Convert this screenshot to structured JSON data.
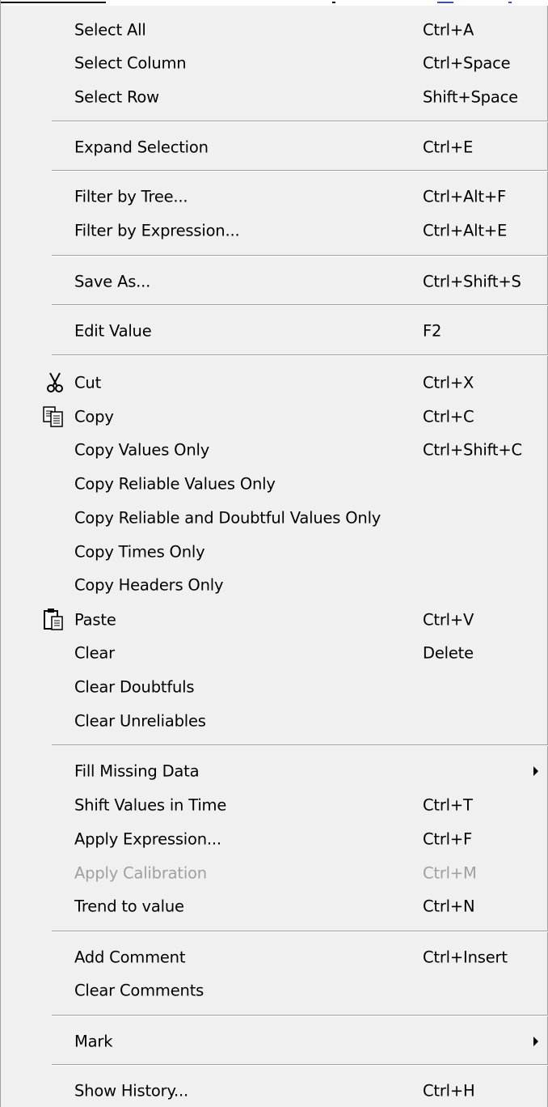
{
  "menu": {
    "items": [
      {
        "label": "Select All",
        "shortcut": "Ctrl+A"
      },
      {
        "label": "Select Column",
        "shortcut": "Ctrl+Space"
      },
      {
        "label": "Select Row",
        "shortcut": "Shift+Space"
      },
      {
        "label": "Expand Selection",
        "shortcut": "Ctrl+E"
      },
      {
        "label": "Filter by Tree...",
        "shortcut": "Ctrl+Alt+F"
      },
      {
        "label": "Filter by Expression...",
        "shortcut": "Ctrl+Alt+E"
      },
      {
        "label": "Save As...",
        "shortcut": "Ctrl+Shift+S"
      },
      {
        "label": "Edit Value",
        "shortcut": "F2"
      },
      {
        "label": "Cut",
        "shortcut": "Ctrl+X",
        "icon": "scissors-icon"
      },
      {
        "label": "Copy",
        "shortcut": "Ctrl+C",
        "icon": "copy-icon"
      },
      {
        "label": "Copy Values Only",
        "shortcut": "Ctrl+Shift+C"
      },
      {
        "label": "Copy Reliable Values Only",
        "shortcut": ""
      },
      {
        "label": "Copy Reliable and Doubtful Values Only",
        "shortcut": ""
      },
      {
        "label": "Copy Times Only",
        "shortcut": ""
      },
      {
        "label": "Copy Headers Only",
        "shortcut": ""
      },
      {
        "label": "Paste",
        "shortcut": "Ctrl+V",
        "icon": "clipboard-paste-icon"
      },
      {
        "label": "Clear",
        "shortcut": "Delete"
      },
      {
        "label": "Clear Doubtfuls",
        "shortcut": ""
      },
      {
        "label": "Clear Unreliables",
        "shortcut": ""
      },
      {
        "label": "Fill Missing Data",
        "shortcut": "",
        "submenu": true
      },
      {
        "label": "Shift Values in Time",
        "shortcut": "Ctrl+T"
      },
      {
        "label": "Apply Expression...",
        "shortcut": "Ctrl+F"
      },
      {
        "label": "Apply Calibration",
        "shortcut": "Ctrl+M",
        "disabled": true
      },
      {
        "label": "Trend to value",
        "shortcut": "Ctrl+N"
      },
      {
        "label": "Add Comment",
        "shortcut": "Ctrl+Insert"
      },
      {
        "label": "Clear Comments",
        "shortcut": ""
      },
      {
        "label": "Mark",
        "shortcut": "",
        "submenu": true
      },
      {
        "label": "Show History...",
        "shortcut": "Ctrl+H"
      }
    ]
  },
  "colors": {
    "menu_background": "#f0f0f0",
    "separator_dark": "#a0a0a0",
    "separator_light": "#ffffff",
    "text": "#000000",
    "disabled_text": "#a0a0a0"
  }
}
